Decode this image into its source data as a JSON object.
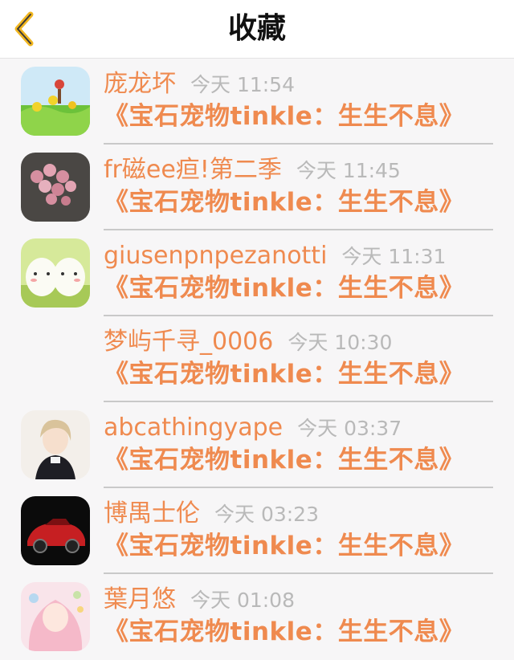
{
  "header": {
    "title": "收藏",
    "back_icon": "chevron-left-icon"
  },
  "colors": {
    "accent": "#ef8a4f",
    "time": "#b9b9b9",
    "back": "#f1b61f"
  },
  "items": [
    {
      "name": "庞龙坏",
      "time": "今天 11:54",
      "title": "《宝石宠物tinkle：生生不息》",
      "avatar": "avatar-flowers-field"
    },
    {
      "name": "fr磁ee疸!第二季",
      "time": "今天 11:45",
      "title": "《宝石宠物tinkle：生生不息》",
      "avatar": "avatar-pink-flowers"
    },
    {
      "name": "giusenpnpezanotti",
      "time": "今天 11:31",
      "title": "《宝石宠物tinkle：生生不息》",
      "avatar": "avatar-cute-eggs"
    },
    {
      "name": "梦屿千寻_0006",
      "time": "今天 10:30",
      "title": "《宝石宠物tinkle：生生不息》",
      "avatar": ""
    },
    {
      "name": "abcathingyape",
      "time": "今天 03:37",
      "title": "《宝石宠物tinkle：生生不息》",
      "avatar": "avatar-anime-boy"
    },
    {
      "name": "博禺士伦",
      "time": "今天 03:23",
      "title": "《宝石宠物tinkle：生生不息》",
      "avatar": "avatar-red-car"
    },
    {
      "name": "葉月悠",
      "time": "今天 01:08",
      "title": "《宝石宠物tinkle：生生不息》",
      "avatar": "avatar-anime-girl"
    }
  ]
}
